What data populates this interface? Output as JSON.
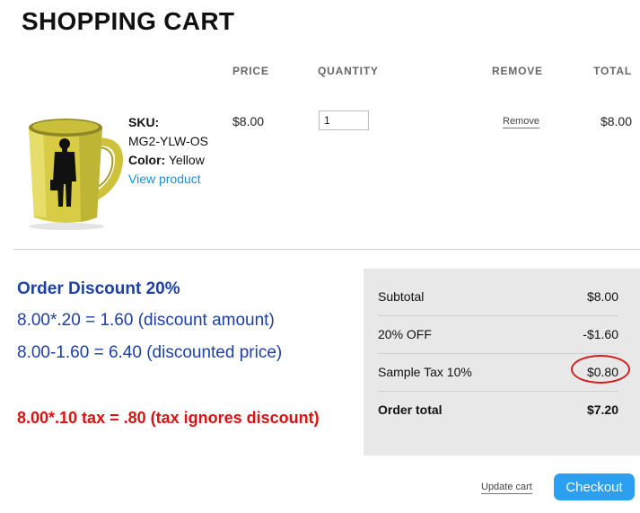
{
  "cart": {
    "title": "SHOPPING CART",
    "columns": {
      "price": "PRICE",
      "quantity": "QUANTITY",
      "remove": "REMOVE",
      "total": "TOTAL"
    },
    "item": {
      "sku_label": "SKU:",
      "sku": "MG2-YLW-OS",
      "color_label": "Color:",
      "color": "Yellow",
      "view_link": "View product",
      "price": "$8.00",
      "quantity": "1",
      "remove_label": "Remove",
      "total": "$8.00"
    }
  },
  "annotation": {
    "title": "Order Discount 20%",
    "line1": "8.00*.20 = 1.60 (discount amount)",
    "line2": "8.00-1.60 = 6.40 (discounted price)",
    "tax_note": "8.00*.10 tax = .80 (tax ignores discount)"
  },
  "summary": {
    "subtotal_label": "Subtotal",
    "subtotal": "$8.00",
    "discount_label": "20% OFF",
    "discount": "-$1.60",
    "tax_label": "Sample Tax",
    "tax_rate": "10%",
    "tax": "$0.80",
    "order_total_label": "Order total",
    "order_total": "$7.20"
  },
  "actions": {
    "update_label": "Update cart",
    "checkout_label": "Checkout"
  },
  "colors": {
    "accent": "#2d9ff0",
    "annotation_blue": "#1d3fa8",
    "annotation_red": "#dd1111",
    "link": "#1a8fd8"
  }
}
